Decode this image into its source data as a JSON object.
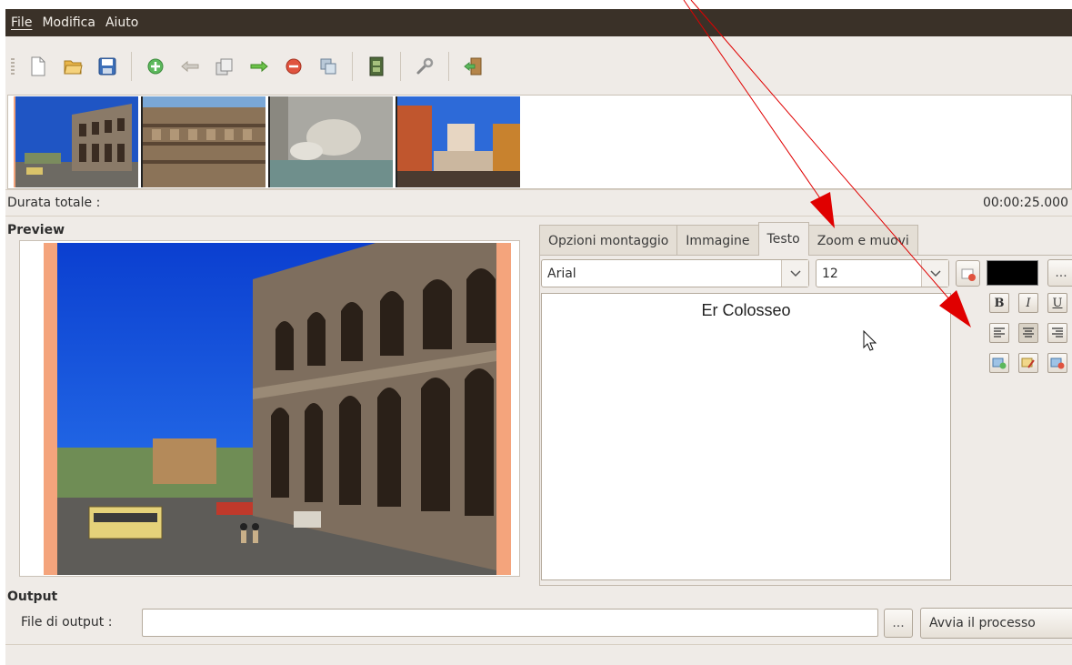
{
  "menubar": {
    "items": [
      "File",
      "Modifica",
      "Aiuto"
    ]
  },
  "toolbar": {
    "buttons": [
      "new-document-icon",
      "open-folder-icon",
      "save-icon",
      "add-icon",
      "arrow-left-icon",
      "image-stack-icon",
      "arrow-right-icon",
      "remove-icon",
      "copy-icon",
      "film-icon",
      "wrench-icon",
      "exit-icon"
    ]
  },
  "timeline": {
    "durata_label": "Durata totale :",
    "durata_value": "00:00:25.000"
  },
  "preview": {
    "title": "Preview"
  },
  "tabs": [
    {
      "label": "Opzioni montaggio"
    },
    {
      "label": "Immagine"
    },
    {
      "label": "Testo"
    },
    {
      "label": "Zoom e muovi"
    }
  ],
  "text_tab": {
    "font": "Arial",
    "size": "12",
    "text": "Er Colosseo",
    "color": "#000000",
    "more_label": "...",
    "bold": "B",
    "italic": "I",
    "underline": "U"
  },
  "output": {
    "title": "Output",
    "file_label": "File di output :",
    "file_value": "",
    "browse_label": "...",
    "start_label": "Avvia il processo"
  },
  "colors": {
    "accent_border": "#f4a47c",
    "annotation_arrow": "#e00000",
    "menubar_bg": "#3a3128"
  }
}
